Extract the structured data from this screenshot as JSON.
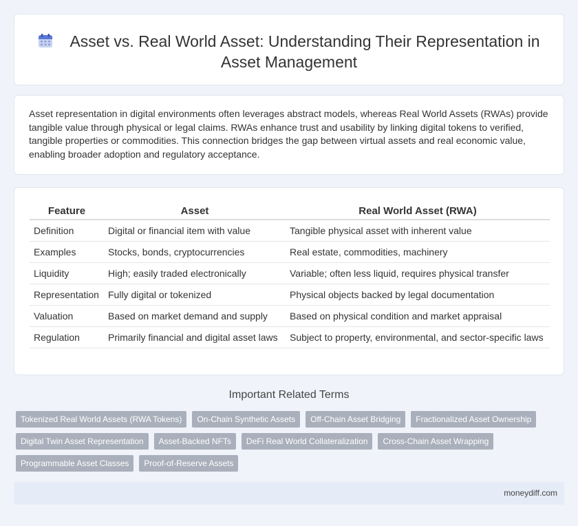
{
  "header": {
    "title": "Asset vs. Real World Asset: Understanding Their Representation in Asset Management",
    "icon": "calendar-icon"
  },
  "intro": {
    "text": "Asset representation in digital environments often leverages abstract models, whereas Real World Assets (RWAs) provide tangible value through physical or legal claims. RWAs enhance trust and usability by linking digital tokens to verified, tangible properties or commodities. This connection bridges the gap between virtual assets and real economic value, enabling broader adoption and regulatory acceptance."
  },
  "table": {
    "headers": [
      "Feature",
      "Asset",
      "Real World Asset (RWA)"
    ],
    "rows": [
      [
        "Definition",
        "Digital or financial item with value",
        "Tangible physical asset with inherent value"
      ],
      [
        "Examples",
        "Stocks, bonds, cryptocurrencies",
        "Real estate, commodities, machinery"
      ],
      [
        "Liquidity",
        "High; easily traded electronically",
        "Variable; often less liquid, requires physical transfer"
      ],
      [
        "Representation",
        "Fully digital or tokenized",
        "Physical objects backed by legal documentation"
      ],
      [
        "Valuation",
        "Based on market demand and supply",
        "Based on physical condition and market appraisal"
      ],
      [
        "Regulation",
        "Primarily financial and digital asset laws",
        "Subject to property, environmental, and sector-specific laws"
      ]
    ]
  },
  "terms": {
    "title": "Important Related Terms",
    "tags": [
      "Tokenized Real World Assets (RWA Tokens)",
      "On-Chain Synthetic Assets",
      "Off-Chain Asset Bridging",
      "Fractionalized Asset Ownership",
      "Digital Twin Asset Representation",
      "Asset-Backed NFTs",
      "DeFi Real World Collateralization",
      "Cross-Chain Asset Wrapping",
      "Programmable Asset Classes",
      "Proof-of-Reserve Assets"
    ]
  },
  "footer": {
    "brand": "moneydiff.com"
  }
}
